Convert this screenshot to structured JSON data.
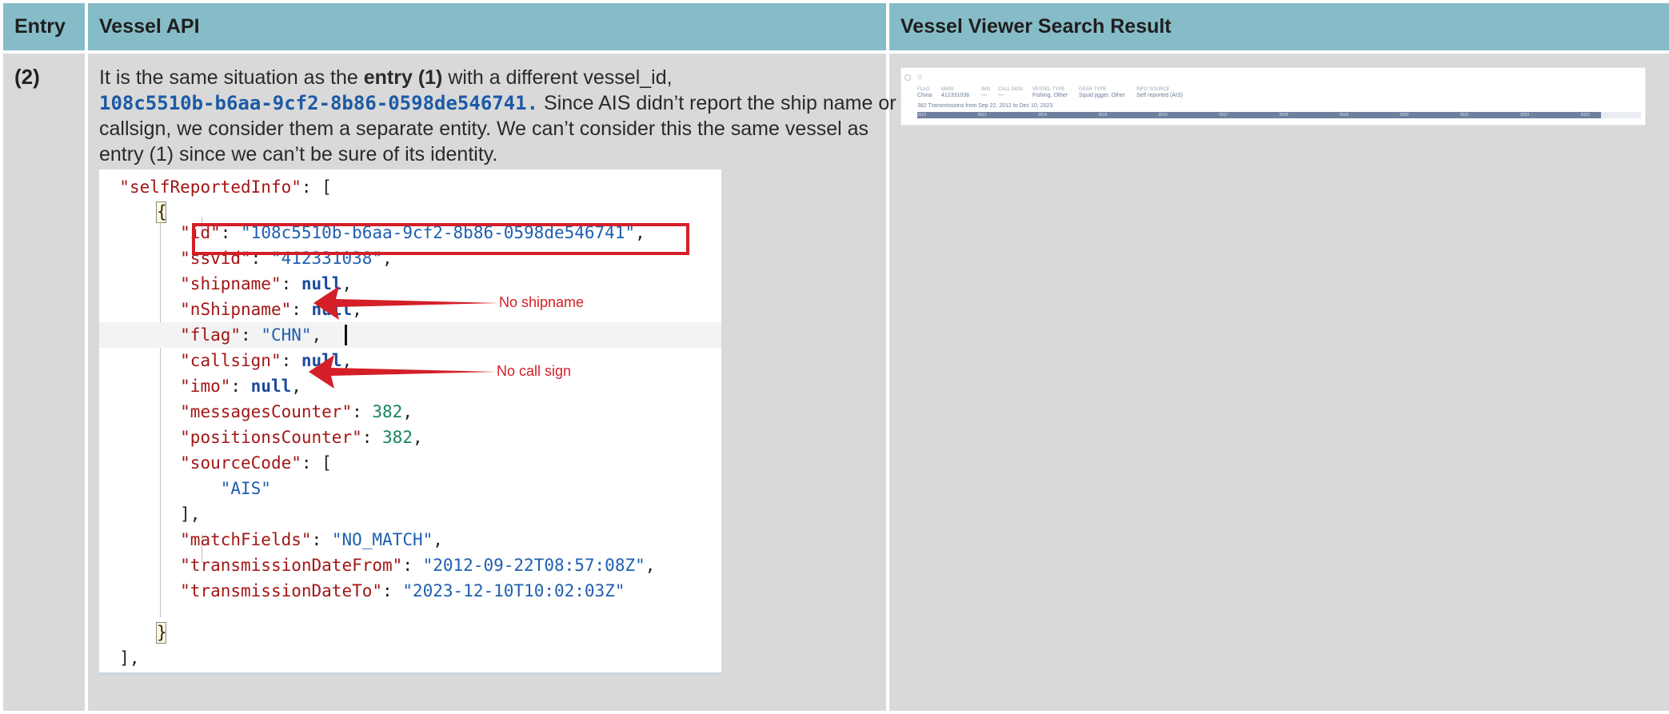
{
  "header": {
    "col_entry": "Entry",
    "col_api": "Vessel API",
    "col_result": "Vessel Viewer Search Result"
  },
  "row": {
    "entry": "(2)",
    "desc_part1": "It is the same situation as the ",
    "desc_bold": "entry (1)",
    "desc_part2": " with a different vessel_id,",
    "vessel_id": "108c5510b-b6aa-9cf2-8b86-0598de546741.",
    "desc_part3": " Since AIS didn’t report the ship name or callsign, we consider them a separate entity. We can’t consider this the same vessel as entry (1) since we can’t be sure of its identity."
  },
  "code": {
    "key_selfReportedInfo": "\"selfReportedInfo\"",
    "open_brace": "{",
    "close_brace": "}",
    "key_id": "\"id\"",
    "val_id": "\"108c5510b-b6aa-9cf2-8b86-0598de546741\"",
    "key_ssvid": "\"ssvid\"",
    "val_ssvid": "\"412331038\"",
    "key_shipname": "\"shipname\"",
    "val_shipname": "null",
    "key_nShipname": "\"nShipname\"",
    "val_nShipname": "null",
    "key_flag": "\"flag\"",
    "val_flag": "\"CHN\"",
    "key_callsign": "\"callsign\"",
    "val_callsign": "null",
    "key_imo": "\"imo\"",
    "val_imo": "null",
    "key_messagesCounter": "\"messagesCounter\"",
    "val_messagesCounter": "382",
    "key_positionsCounter": "\"positionsCounter\"",
    "val_positionsCounter": "382",
    "key_sourceCode": "\"sourceCode\"",
    "val_sourceCode_item": "\"AIS\"",
    "key_matchFields": "\"matchFields\"",
    "val_matchFields": "\"NO_MATCH\"",
    "key_transmissionDateFrom": "\"transmissionDateFrom\"",
    "val_transmissionDateFrom": "\"2012-09-22T08:57:08Z\"",
    "key_transmissionDateTo": "\"transmissionDateTo\"",
    "val_transmissionDateTo": "\"2023-12-10T10:02:03Z\""
  },
  "annotations": {
    "no_shipname": "No shipname",
    "no_callsign": "No call sign"
  },
  "viewer": {
    "labels": {
      "flag": "FLAG",
      "mmsi": "MMSI",
      "imo": "IMO",
      "call_sign": "CALL SIGN",
      "vessel_type": "VESSEL TYPE",
      "gear_type": "GEAR TYPE",
      "info_source": "INFO SOURCE"
    },
    "values": {
      "flag": "China",
      "mmsi": "412331038",
      "imo": "---",
      "call_sign": "---",
      "vessel_type": "Fishing, Other",
      "gear_type": "Squid jigger, Other",
      "info_source": "Self reported (AIS)"
    },
    "transmissions": "382 Transmissions from Sep 22, 2012 to Dec 10, 2023",
    "timeline_years": [
      "2012",
      "2013",
      "2014",
      "2015",
      "2016",
      "2017",
      "2018",
      "2019",
      "2020",
      "2021",
      "2022",
      "2023"
    ],
    "coverage_fraction": 0.945
  }
}
